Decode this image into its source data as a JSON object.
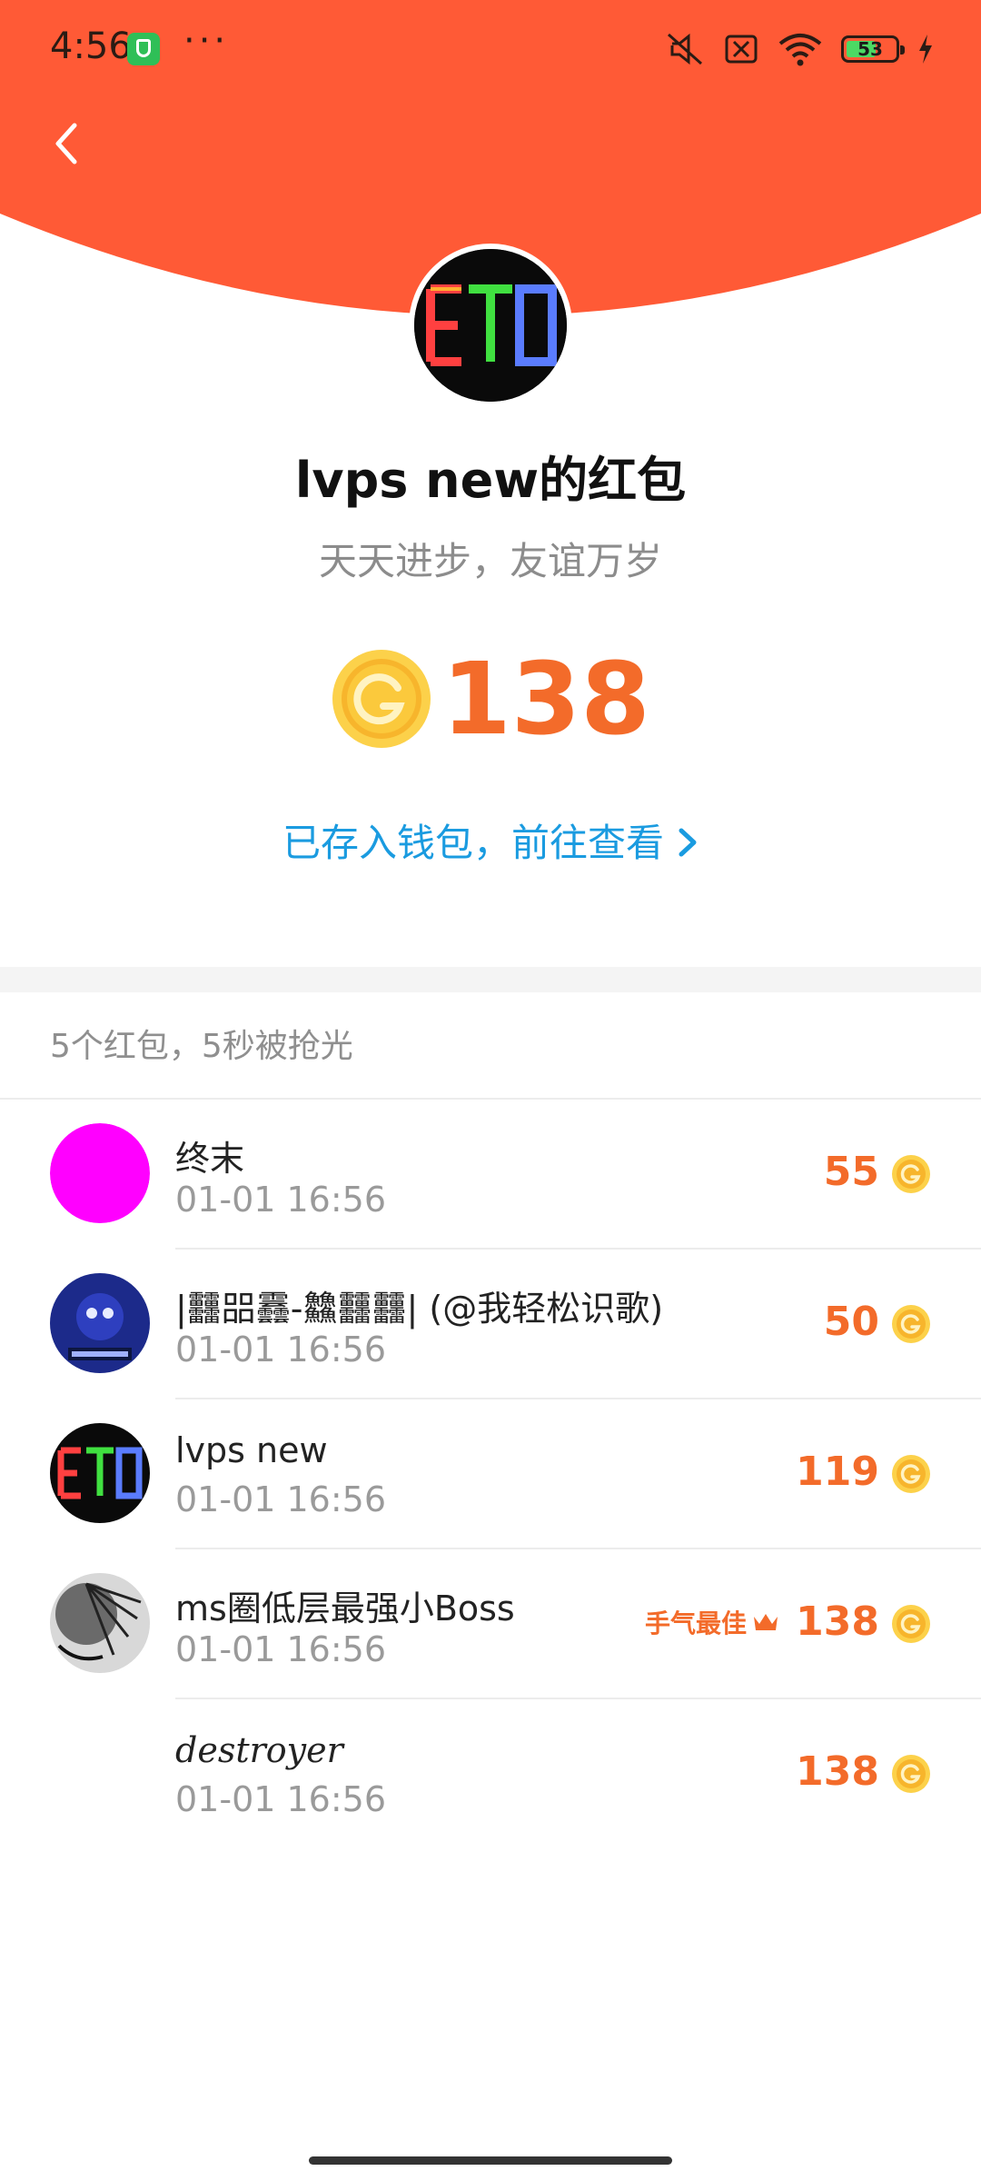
{
  "status_bar": {
    "time": "4:56",
    "more": "···",
    "battery": "53"
  },
  "colors": {
    "header": "#ff5a36",
    "accent": "#f36b2a",
    "link": "#1a9be0"
  },
  "packet": {
    "title": "lvps new的红包",
    "message": "天天进步，友谊万岁",
    "amount": "138",
    "wallet_link": "已存入钱包，前往查看",
    "summary": "5个红包，5秒被抢光"
  },
  "records": [
    {
      "name": "终末",
      "time": "01-01 16:56",
      "amount": "55",
      "avatar": "magenta-circle"
    },
    {
      "name": "|䨻㗊䨺-䲜䨻䨻| (@我轻松识歌)",
      "time": "01-01 16:56",
      "amount": "50",
      "avatar": "blue-character"
    },
    {
      "name": "lvps new",
      "time": "01-01 16:56",
      "amount": "119",
      "avatar": "eto-logo"
    },
    {
      "name": "ms圈低层最强小Boss",
      "time": "01-01 16:56",
      "amount": "138",
      "avatar": "sketch",
      "badge": "手气最佳"
    },
    {
      "name": "destroyer",
      "time": "01-01 16:56",
      "amount": "138",
      "avatar": "none"
    }
  ]
}
